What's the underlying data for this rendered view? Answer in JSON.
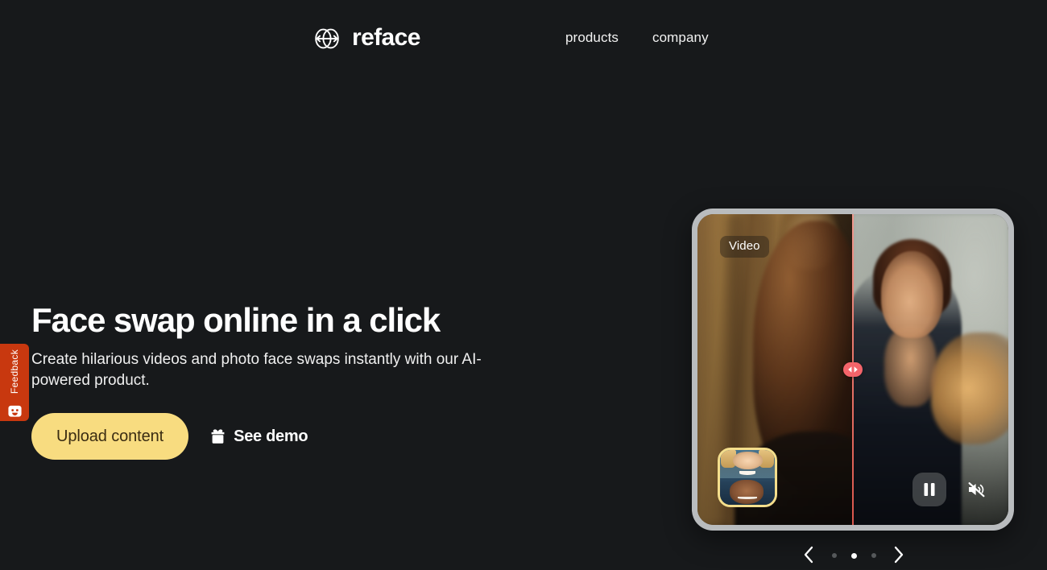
{
  "page": {
    "background_color": "#17191b"
  },
  "header": {
    "brand": {
      "name": "reface",
      "logo_icon": "reface-globe-arrows-icon"
    },
    "nav": [
      {
        "label": "products"
      },
      {
        "label": "company"
      }
    ]
  },
  "feedback": {
    "label": "Feedback",
    "icon": "smiley-face-icon",
    "color": "#c8380f"
  },
  "hero": {
    "title": "Face swap online in a click",
    "subtitle": "Create hilarious videos and photo face swaps instantly with our AI-powered product.",
    "primary_button": {
      "label": "Upload content",
      "color": "#f8dc80",
      "text_color": "#3a2c12"
    },
    "secondary_button": {
      "label": "See demo",
      "icon": "gift-box-icon"
    }
  },
  "video_card": {
    "badge": "Video",
    "split_handle_icon": "left-right-arrows-icon",
    "split_handle_color": "#f4646a",
    "thumbnail": {
      "name": "face-source-thumbnail",
      "border_color": "#f4de8c"
    },
    "controls": [
      {
        "name": "pause-button",
        "icon": "pause-icon"
      },
      {
        "name": "mute-button",
        "icon": "speaker-muted-icon"
      }
    ]
  },
  "carousel": {
    "prev_icon": "chevron-left-icon",
    "next_icon": "chevron-right-icon",
    "dots": [
      {
        "active": false
      },
      {
        "active": true
      },
      {
        "active": false
      }
    ],
    "active_index": 1
  }
}
